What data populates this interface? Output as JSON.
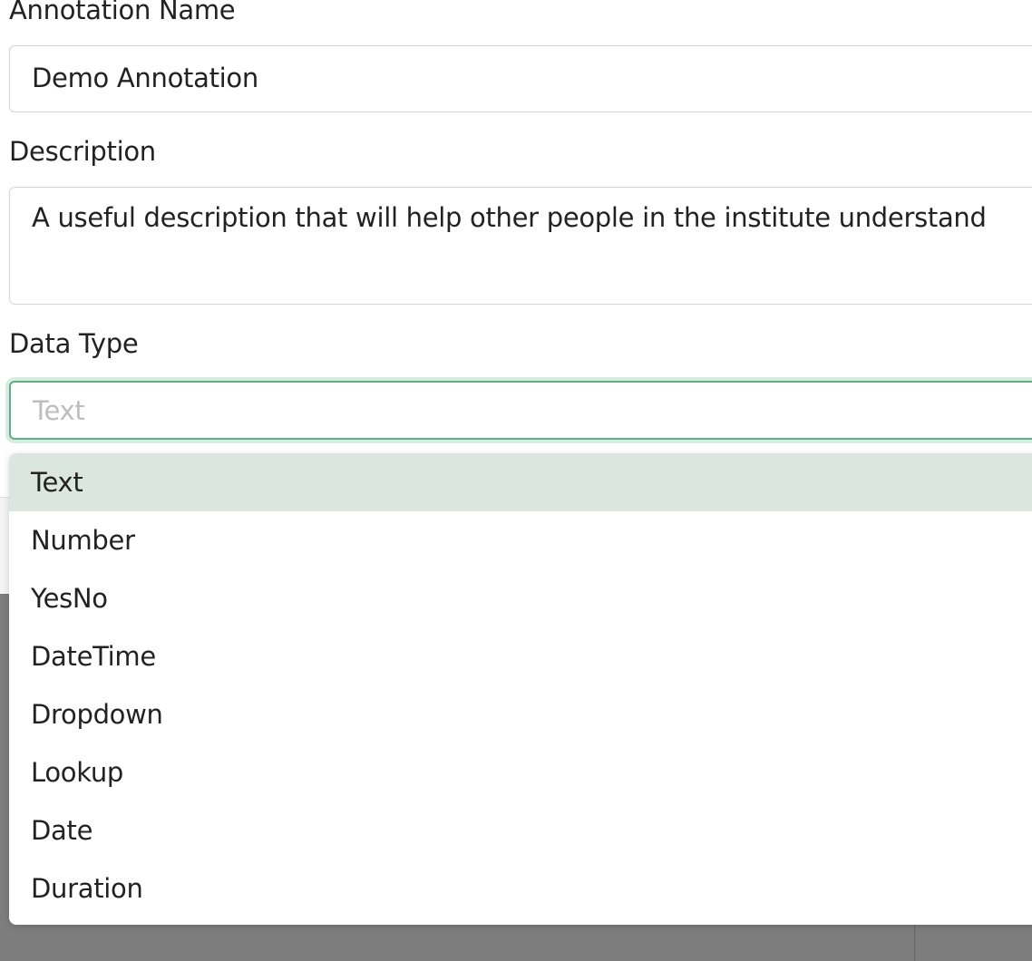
{
  "form": {
    "name_label": "Annotation Name",
    "name_value": "Demo Annotation",
    "description_label": "Description",
    "description_value": "A useful description that will help other people in the institute understand",
    "data_type_label": "Data Type",
    "data_type_placeholder": "Text"
  },
  "dropdown": {
    "highlighted": "Text",
    "options": [
      "Text",
      "Number",
      "YesNo",
      "DateTime",
      "Dropdown",
      "Lookup",
      "Date",
      "Duration"
    ]
  },
  "colors": {
    "focus_border": "#5fae86",
    "highlight": "#dbe6de"
  }
}
